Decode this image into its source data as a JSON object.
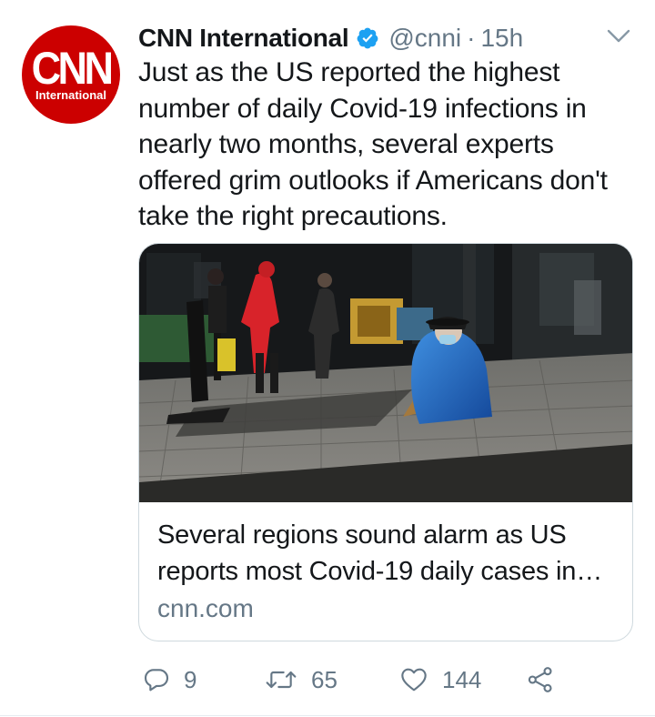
{
  "tweet": {
    "author": {
      "display_name": "CNN International",
      "handle": "@cnni",
      "separator": "·",
      "time": "15h",
      "verified": true,
      "avatar": {
        "logo_text": "CNN",
        "logo_subtext": "International",
        "background_color": "#cc0000"
      }
    },
    "text": "Just as the US reported the highest number of daily Covid-19 infections in nearly two months, several experts offered grim outlooks if Americans don't take the right precautions.",
    "card": {
      "image_icon": "street-photo-masked-man-sitting",
      "title": "Several regions sound alarm as US reports most Covid-19 daily cases in…",
      "domain": "cnn.com"
    },
    "actions": {
      "reply": {
        "icon": "reply-icon",
        "count": "9"
      },
      "retweet": {
        "icon": "retweet-icon",
        "count": "65"
      },
      "like": {
        "icon": "heart-icon",
        "count": "144"
      },
      "share": {
        "icon": "share-icon"
      }
    }
  },
  "colors": {
    "text_primary": "#14171a",
    "text_secondary": "#657786",
    "verified_blue": "#1da1f2",
    "border": "#cfd9de",
    "brand_red": "#cc0000"
  }
}
